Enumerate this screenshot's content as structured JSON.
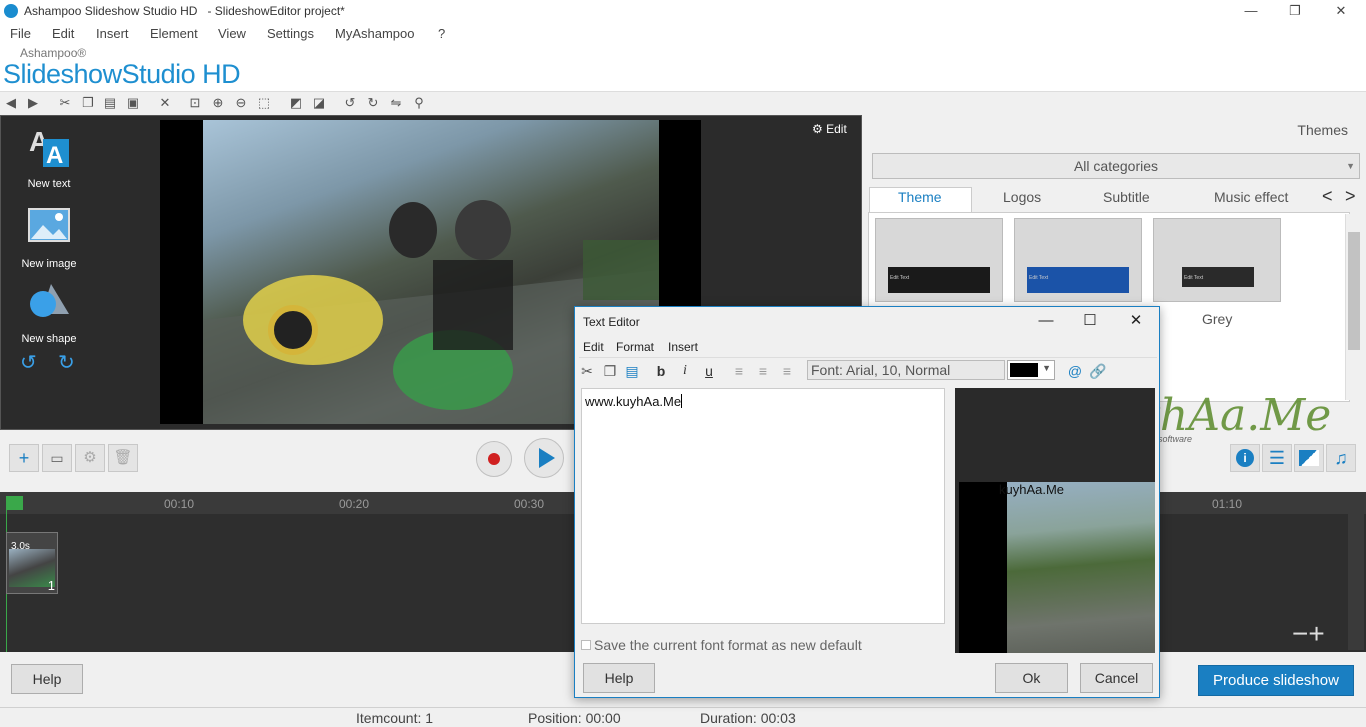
{
  "window": {
    "title": "Ashampoo Slideshow Studio HD",
    "subtitle": "- SlideshowEditor project*",
    "minimize": "—",
    "maximize": "❐",
    "close": "✕"
  },
  "menu": [
    "File",
    "Edit",
    "Insert",
    "Element",
    "View",
    "Settings",
    "MyAshampoo",
    "?"
  ],
  "brand": {
    "small": "Ashampoo®",
    "big": "SlideshowStudio HD"
  },
  "left_tools": {
    "new_text": "New text",
    "new_image": "New image",
    "new_shape": "New shape"
  },
  "preview": {
    "edit_label": "Edit"
  },
  "timeline": {
    "ticks": [
      "00:10",
      "00:20",
      "00:30",
      "01:10"
    ],
    "clip_duration": "3.0s",
    "clip_index": "1"
  },
  "themes": {
    "header": "Themes",
    "category": "All categories",
    "tabs": [
      "Theme",
      "Logos",
      "Subtitle",
      "Music effect"
    ],
    "active_tab": "Theme",
    "items": [
      {
        "label": "",
        "bar_color": "#1a1a1a",
        "bar_text": "Edit Text"
      },
      {
        "label": "",
        "bar_color": "#1b53a8",
        "bar_text": "Edit Text"
      },
      {
        "label": "Grey",
        "bar_color": "#2a2a2a",
        "bar_text": "Edit Text"
      }
    ]
  },
  "watermark": {
    "text": "kuyhAa.Me",
    "tagline": "Free download software"
  },
  "bottom": {
    "help": "Help",
    "produce": "Produce slideshow"
  },
  "status": {
    "itemcount": "Itemcount: 1",
    "position": "Position: 00:00",
    "duration": "Duration: 00:03"
  },
  "dialog": {
    "title": "Text Editor",
    "menu": [
      "Edit",
      "Format",
      "Insert"
    ],
    "font": "Font: Arial, 10, Normal",
    "font_color": "#000000",
    "text": "www.kuyhAa.Me",
    "preview_text": "kuyhAa.Me",
    "save_default": "Save the current font format as new default",
    "help": "Help",
    "ok": "Ok",
    "cancel": "Cancel"
  },
  "colors": {
    "accent": "#1a7fc2",
    "dark_panel": "#2b2b2b",
    "timeline": "#2e2e2e"
  }
}
